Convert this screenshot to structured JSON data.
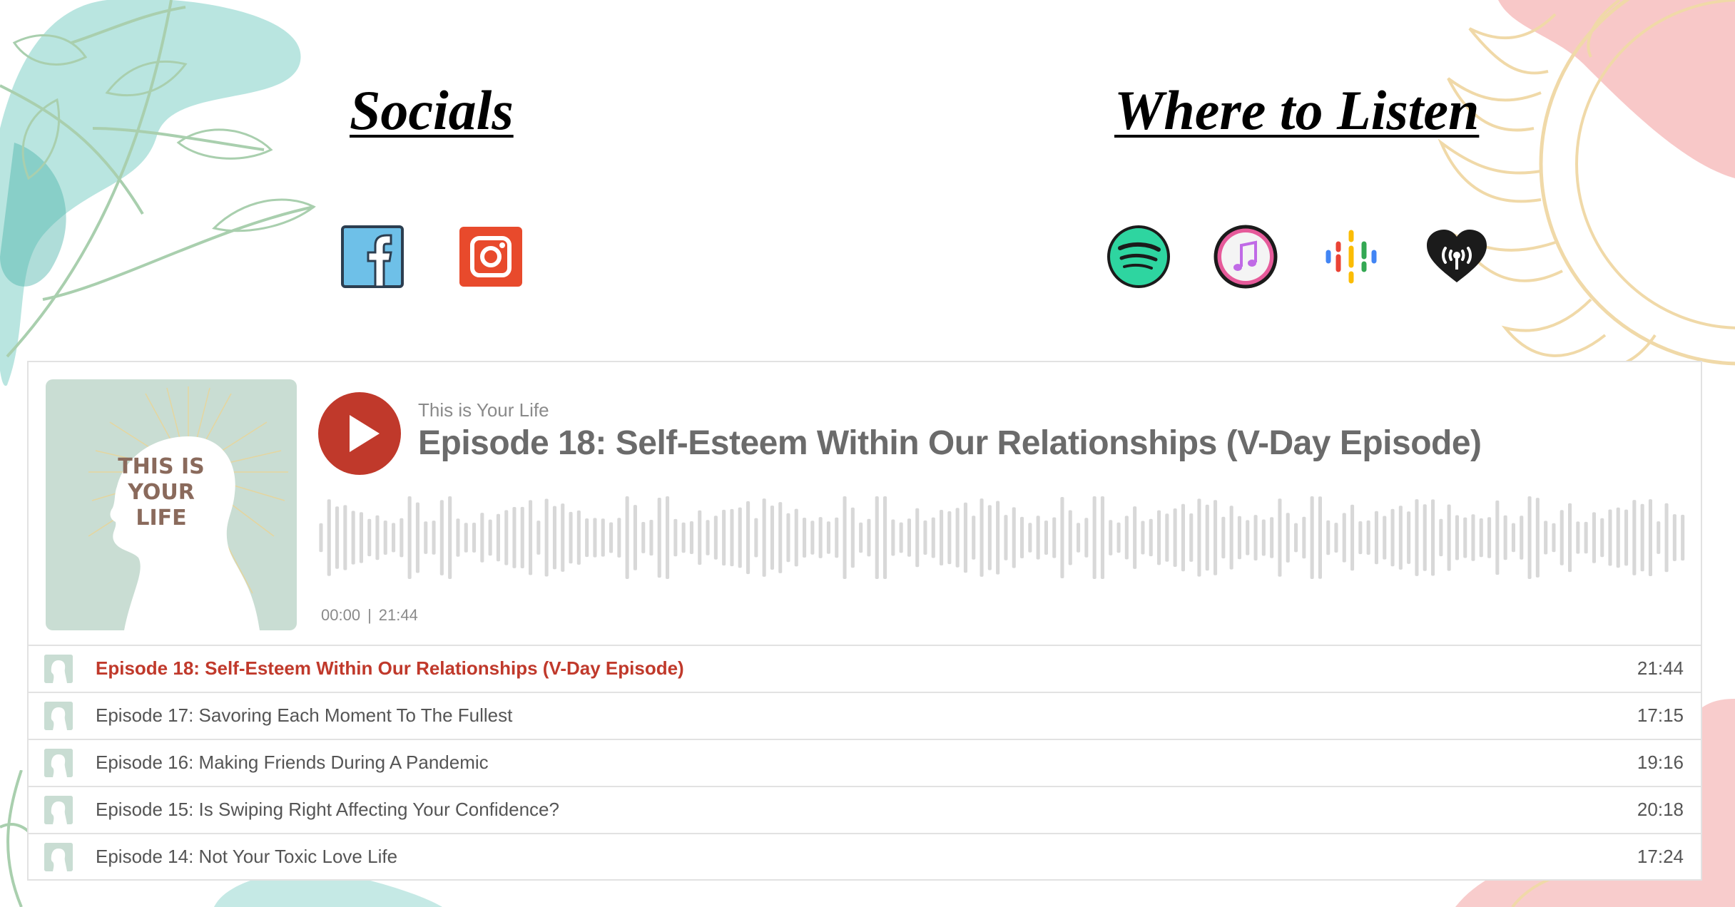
{
  "colors": {
    "accent": "#c0392b",
    "cover_bg": "#c9ddd3",
    "wave": "#d8d8d8"
  },
  "socials": {
    "heading": "Socials",
    "icons": [
      {
        "name": "facebook-icon"
      },
      {
        "name": "instagram-icon"
      }
    ]
  },
  "listen": {
    "heading": "Where to Listen",
    "icons": [
      {
        "name": "spotify-icon"
      },
      {
        "name": "apple-podcasts-icon"
      },
      {
        "name": "google-podcasts-icon"
      },
      {
        "name": "iheartradio-icon"
      }
    ]
  },
  "player": {
    "show_name": "This is Your Life",
    "episode_title": "Episode 18: Self-Esteem Within Our Relationships (V-Day Episode)",
    "current_time": "00:00",
    "separator": "|",
    "total_time": "21:44",
    "cover_text": [
      "THIS IS",
      "YOUR",
      "LIFE"
    ],
    "play_icon": "play-icon"
  },
  "episodes": [
    {
      "title": "Episode 18: Self-Esteem Within Our Relationships (V-Day Episode)",
      "duration": "21:44",
      "active": true
    },
    {
      "title": "Episode 17: Savoring Each Moment To The Fullest",
      "duration": "17:15",
      "active": false
    },
    {
      "title": "Episode 16: Making Friends During A Pandemic",
      "duration": "19:16",
      "active": false
    },
    {
      "title": "Episode 15: Is Swiping Right Affecting Your Confidence?",
      "duration": "20:18",
      "active": false
    },
    {
      "title": "Episode 14: Not Your Toxic Love Life",
      "duration": "17:24",
      "active": false
    }
  ]
}
